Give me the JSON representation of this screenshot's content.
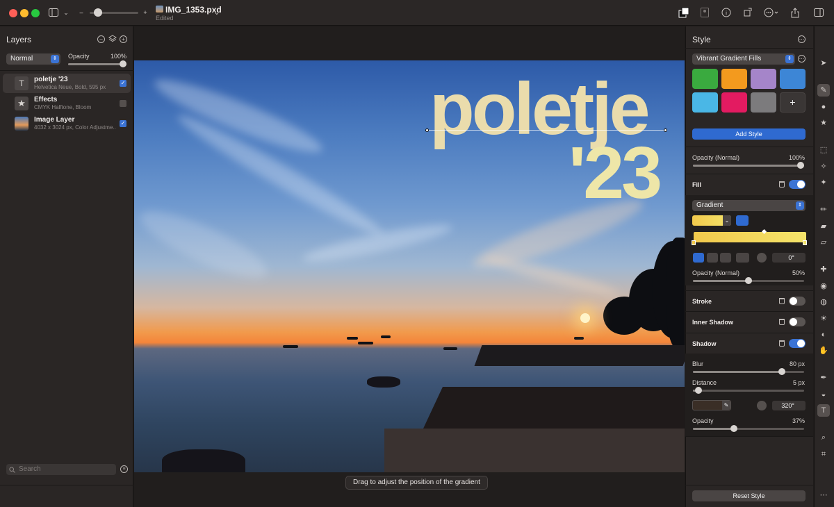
{
  "window": {
    "doc_title": "IMG_1353.pxd",
    "doc_status": "Edited"
  },
  "layers_panel": {
    "title": "Layers",
    "blend_mode": "Normal",
    "opacity_label": "Opacity",
    "opacity_value": "100%",
    "opacity_fraction": 1.0,
    "layers": [
      {
        "name": "poletje  '23",
        "desc": "Helvetica Neue, Bold, 595 px",
        "visible": true,
        "icon": "text-icon"
      },
      {
        "name": "Effects",
        "desc": "CMYK Halftone, Bloom",
        "visible": false,
        "icon": "effects-star-icon"
      },
      {
        "name": "Image Layer",
        "desc": "4032 x 3024 px, Color Adjustme...",
        "visible": true,
        "icon": "image-thumbnail"
      }
    ],
    "search_placeholder": "Search"
  },
  "canvas": {
    "text_line1": "poletje",
    "text_line2": "'23",
    "tooltip": "Drag to adjust the position of the gradient"
  },
  "style_panel": {
    "title": "Style",
    "preset_select": "Vibrant Gradient Fills",
    "swatches": [
      "#3aaa3f",
      "#f39a1e",
      "#a585c9",
      "#3d86d6",
      "#4ab7e6",
      "#e31b61",
      "#7c7b7d"
    ],
    "add_swatch_label": "+",
    "add_style_label": "Add Style",
    "opacity_label": "Opacity (Normal)",
    "opacity_value": "100%",
    "opacity_fraction": 1.0,
    "fill": {
      "label": "Fill",
      "enabled": true,
      "type": "Gradient",
      "angle": "0°",
      "opacity_label": "Opacity (Normal)",
      "opacity_value": "50%",
      "opacity_fraction": 0.5
    },
    "stroke": {
      "label": "Stroke",
      "enabled": false
    },
    "inner_shadow": {
      "label": "Inner Shadow",
      "enabled": false
    },
    "shadow": {
      "label": "Shadow",
      "enabled": true,
      "blur_label": "Blur",
      "blur_value": "80 px",
      "blur_fraction": 0.8,
      "distance_label": "Distance",
      "distance_value": "5 px",
      "distance_fraction": 0.05,
      "angle": "320°",
      "opacity_label": "Opacity",
      "opacity_value": "37%",
      "opacity_fraction": 0.37
    },
    "reset_label": "Reset Style"
  },
  "colors": {
    "accent": "#3b73d4",
    "text_fill": "#eadcac",
    "gradient_start": "#f2c94c",
    "gradient_end": "#f4e46b"
  }
}
